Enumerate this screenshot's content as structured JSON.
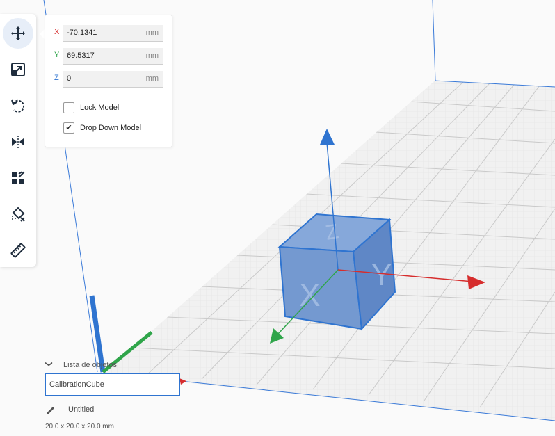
{
  "move_panel": {
    "x": {
      "axis": "X",
      "value": "-70.1341",
      "unit": "mm",
      "color": "#d62d2d"
    },
    "y": {
      "axis": "Y",
      "value": "69.5317",
      "unit": "mm",
      "color": "#2fa54a"
    },
    "z": {
      "axis": "Z",
      "value": "0",
      "unit": "mm",
      "color": "#2f74d0"
    },
    "lock_model": {
      "label": "Lock Model",
      "checked": false
    },
    "drop_down_model": {
      "label": "Drop Down Model",
      "checked": true,
      "mark": "✔"
    }
  },
  "toolbar": {
    "tools": [
      "move-icon",
      "scale-icon",
      "rotate-icon",
      "mirror-icon",
      "per-model-settings-icon",
      "support-blocker-icon",
      "measure-icon"
    ],
    "active": "move-icon"
  },
  "object_list": {
    "title": "Lista de objetos",
    "selected_object": "CalibrationCube",
    "project_name": "Untitled",
    "dimensions": "20.0 x 20.0 x 20.0 mm"
  },
  "colors": {
    "accent": "#2f74d0",
    "model": "#6b95cf",
    "x_axis": "#d62d2d",
    "y_axis": "#2fa54a",
    "z_axis": "#2f74d0"
  }
}
